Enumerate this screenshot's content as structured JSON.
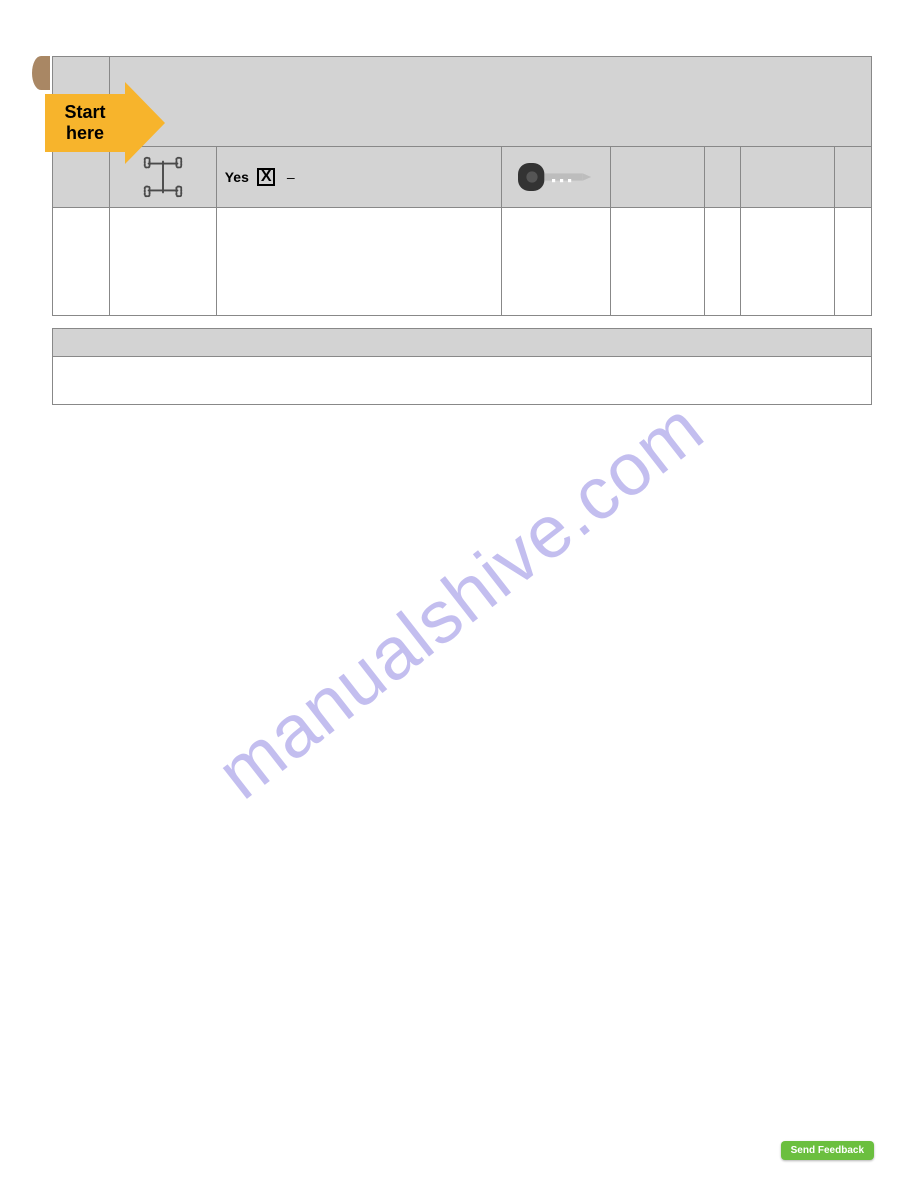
{
  "arrow": {
    "line1": "Start",
    "line2": "here"
  },
  "subrow": {
    "yes_label": "Yes",
    "dash": "–"
  },
  "watermark": "manualshive.com",
  "feedback": "Send Feedback"
}
